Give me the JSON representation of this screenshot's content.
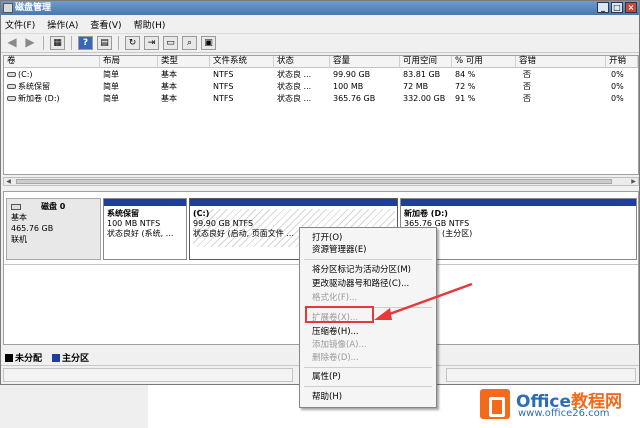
{
  "window": {
    "title": "磁盘管理"
  },
  "menubar": [
    "文件(F)",
    "操作(A)",
    "查看(V)",
    "帮助(H)"
  ],
  "toolbar": {
    "help": "?"
  },
  "table": {
    "headers": [
      "卷",
      "布局",
      "类型",
      "文件系统",
      "状态",
      "容量",
      "可用空间",
      "% 可用",
      "容错",
      "开销"
    ],
    "rows": [
      [
        "(C:)",
        "简单",
        "基本",
        "NTFS",
        "状态良 ...",
        "99.90 GB",
        "83.81 GB",
        "84 %",
        "否",
        "0%"
      ],
      [
        "系统保留",
        "简单",
        "基本",
        "NTFS",
        "状态良 ...",
        "100 MB",
        "72 MB",
        "72 %",
        "否",
        "0%"
      ],
      [
        "新加卷 (D:)",
        "简单",
        "基本",
        "NTFS",
        "状态良 ...",
        "365.76 GB",
        "332.00 GB",
        "91 %",
        "否",
        "0%"
      ]
    ]
  },
  "disk": {
    "name": "磁盘 0",
    "type": "基本",
    "size": "465.76 GB",
    "status": "联机",
    "partitions": [
      {
        "name": "系统保留",
        "size_fs": "100 MB NTFS",
        "status": "状态良好 (系统, ..."
      },
      {
        "name": "(C:)",
        "size_fs": "99.90 GB NTFS",
        "status": "状态良好 (启动, 页面文件 ..."
      },
      {
        "name": "新加卷 (D:)",
        "size_fs": "365.76 GB NTFS",
        "status": "(主分区)"
      }
    ]
  },
  "legend": [
    {
      "label": "未分配",
      "color": "#000000"
    },
    {
      "label": "主分区",
      "color": "#1f3f9e"
    }
  ],
  "context_menu": {
    "items": [
      {
        "label": "打开(O)",
        "disabled": false
      },
      {
        "label": "资源管理器(E)",
        "disabled": false
      },
      {
        "label": "将分区标记为活动分区(M)",
        "disabled": false
      },
      {
        "label": "更改驱动器号和路径(C)...",
        "disabled": false
      },
      {
        "label": "格式化(F)...",
        "disabled": true
      },
      {
        "label": "扩展卷(X)...",
        "disabled": true
      },
      {
        "label": "压缩卷(H)...",
        "disabled": false
      },
      {
        "label": "添加镜像(A)...",
        "disabled": true
      },
      {
        "label": "删除卷(D)...",
        "disabled": true
      },
      {
        "label": "属性(P)",
        "disabled": false
      },
      {
        "label": "帮助(H)",
        "disabled": false
      }
    ]
  },
  "watermark": {
    "brand_en": "Office",
    "brand_cn": "教程网",
    "url": "www.office26.com"
  },
  "colors": {
    "primary_partition": "#1f3f9e",
    "highlight": "#e5393b",
    "watermark_orange": "#f26b1d",
    "watermark_blue": "#2d6db5"
  }
}
